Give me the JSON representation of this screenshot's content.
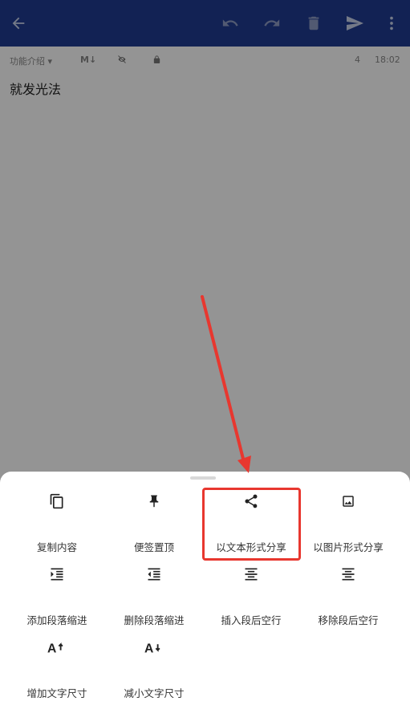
{
  "appbar": {
    "back_icon": "arrow-left-icon",
    "undo_icon": "undo-icon",
    "redo_icon": "redo-icon",
    "delete_icon": "trash-icon",
    "send_icon": "send-icon",
    "more_icon": "more-vertical-icon",
    "color": "#1f3c91"
  },
  "meta": {
    "category": "功能介绍",
    "markdown_label": "M↓",
    "char_count": "4",
    "time": "18:02"
  },
  "note": {
    "title": "就发光法"
  },
  "sheet": {
    "items": [
      {
        "label": "复制内容",
        "icon": "copy-icon"
      },
      {
        "label": "便签置顶",
        "icon": "pin-icon"
      },
      {
        "label": "以文本形式分享",
        "icon": "share-icon"
      },
      {
        "label": "以图片形式分享",
        "icon": "image-icon"
      },
      {
        "label": "添加段落缩进",
        "icon": "indent-increase-icon"
      },
      {
        "label": "删除段落缩进",
        "icon": "indent-decrease-icon"
      },
      {
        "label": "插入段后空行",
        "icon": "insert-blank-line-icon"
      },
      {
        "label": "移除段后空行",
        "icon": "remove-blank-line-icon"
      },
      {
        "label": "增加文字尺寸",
        "icon": "font-size-increase-icon"
      },
      {
        "label": "减小文字尺寸",
        "icon": "font-size-decrease-icon"
      }
    ],
    "highlight_color": "#e8372f"
  }
}
